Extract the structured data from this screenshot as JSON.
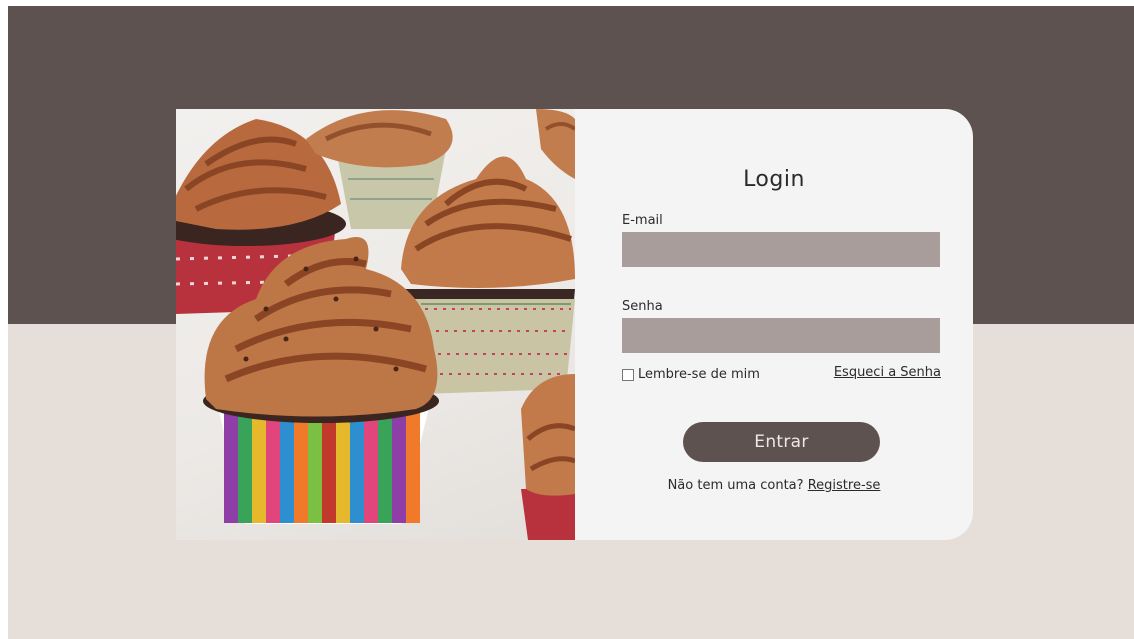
{
  "login": {
    "title": "Login",
    "email_label": "E-mail",
    "email_value": "",
    "password_label": "Senha",
    "password_value": "",
    "remember_label": "Lembre-se de mim",
    "remember_checked": false,
    "forgot_link": "Esqueci a Senha",
    "submit_label": "Entrar",
    "no_account_text": "Não tem uma conta?",
    "register_link": "Registre-se"
  },
  "image": {
    "subject": "chocolate-frosted-cupcakes-photo"
  },
  "colors": {
    "top_band": "#5e5250",
    "bottom_band": "#e6dfd9",
    "card": "#f4f4f4",
    "input": "#a89d9a",
    "button": "#5e5250",
    "button_text": "#efe7e3"
  }
}
